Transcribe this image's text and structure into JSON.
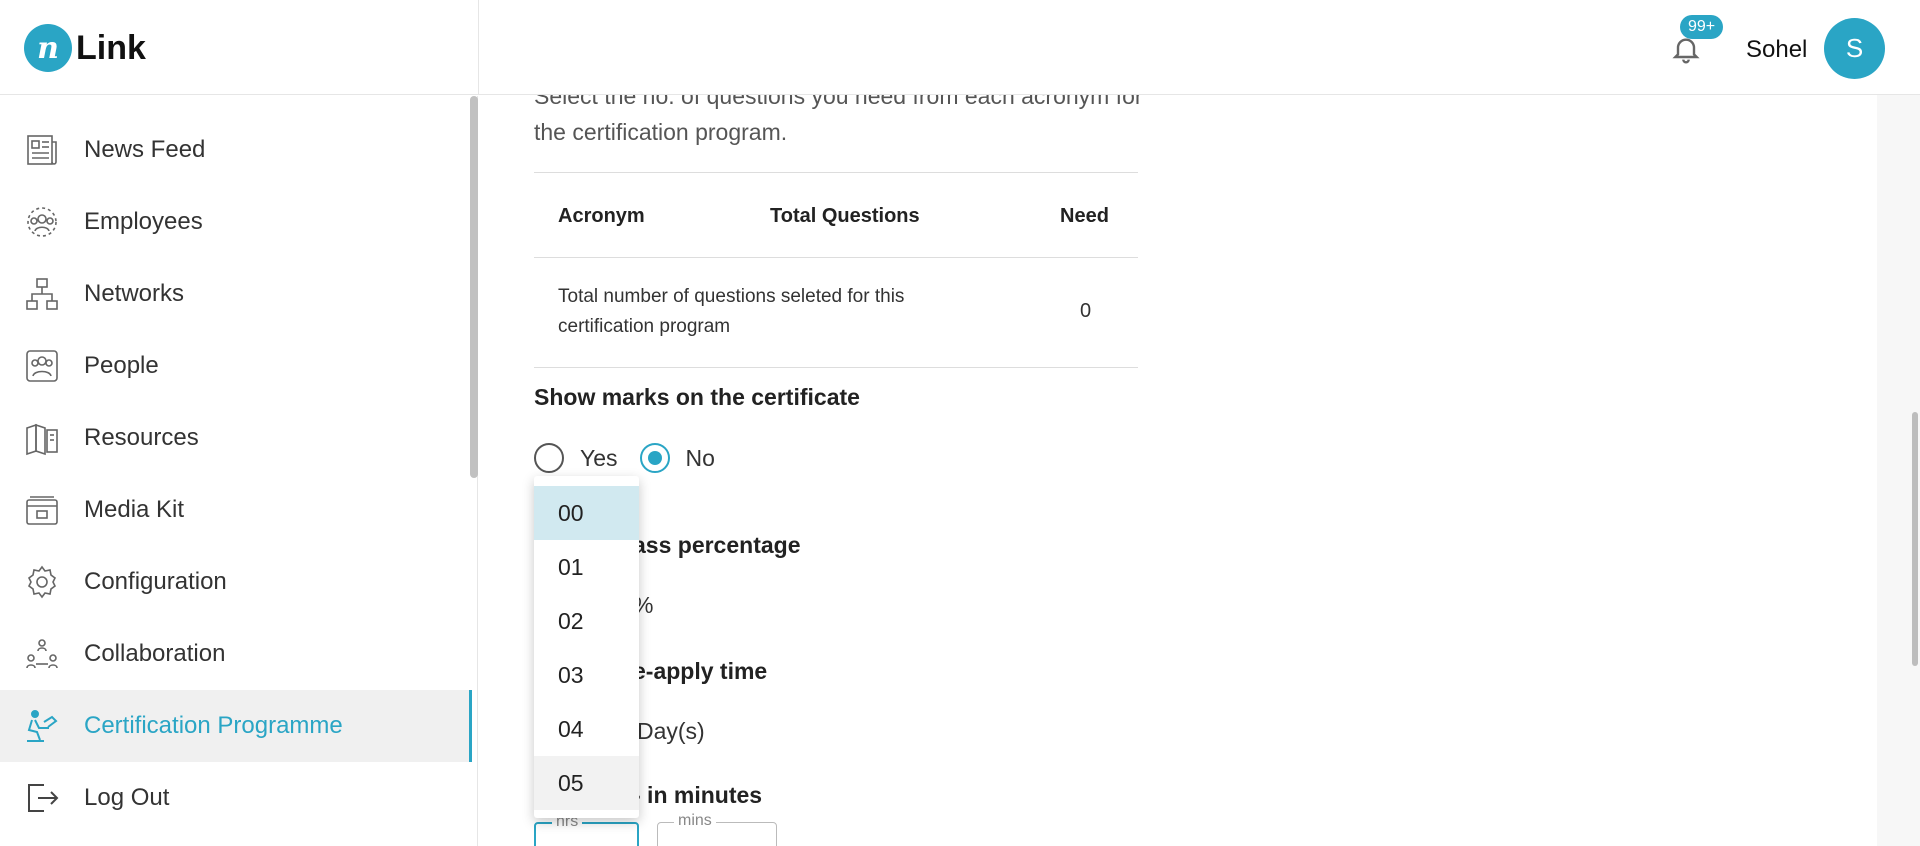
{
  "header": {
    "logo_mark": "n",
    "logo_text": "Link",
    "notification_badge": "99+",
    "user_name": "Sohel",
    "avatar_initial": "S"
  },
  "sidebar": {
    "items": [
      {
        "label": "News Feed",
        "icon": "news-feed-icon"
      },
      {
        "label": "Employees",
        "icon": "employees-icon"
      },
      {
        "label": "Networks",
        "icon": "networks-icon"
      },
      {
        "label": "People",
        "icon": "people-icon"
      },
      {
        "label": "Resources",
        "icon": "resources-icon"
      },
      {
        "label": "Media Kit",
        "icon": "media-kit-icon"
      },
      {
        "label": "Configuration",
        "icon": "gear-icon"
      },
      {
        "label": "Collaboration",
        "icon": "collaboration-icon"
      },
      {
        "label": "Certification Programme",
        "icon": "certification-icon",
        "active": true
      },
      {
        "label": "Log Out",
        "icon": "logout-icon"
      }
    ]
  },
  "main": {
    "intro_text": "Select the no. of questions you need from each acronym for the certification program.",
    "table": {
      "headers": [
        "Acronym",
        "Total Questions",
        "Need"
      ],
      "total_row_text": "Total number of questions seleted for this certification program",
      "total_row_value": "0"
    },
    "show_marks": {
      "label": "Show marks on the certificate",
      "options": [
        "Yes",
        "No"
      ],
      "selected": "No"
    },
    "pass_percentage_label": "ass percentage",
    "pass_percentage_unit": "%",
    "reapply_label": "e-apply time",
    "reapply_unit": "Day(s)",
    "duration_label": "- in minutes",
    "hrs_label": "hrs",
    "mins_label": "mins"
  },
  "dropdown": {
    "options": [
      "00",
      "01",
      "02",
      "03",
      "04",
      "05"
    ],
    "selected": "00",
    "hovered": "05"
  },
  "colors": {
    "accent": "#2aa5c5",
    "selected_option_bg": "#d1e9f0"
  }
}
